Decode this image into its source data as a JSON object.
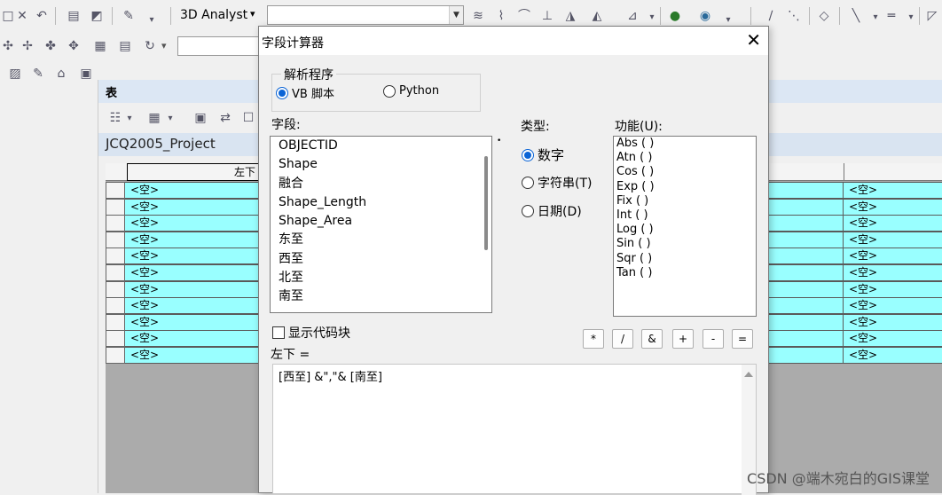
{
  "toolbar": {
    "analyst_label": "3D Analyst",
    "analyst_arrow": "▾",
    "refresh_arrow": "▾"
  },
  "table_window": {
    "title": "表",
    "table_name": "JCQ2005_Project",
    "column_header": "左下",
    "null_value": "<空>",
    "row_count_visible": 11
  },
  "dialog": {
    "title": "字段计算器",
    "close_label": "✕",
    "parser_legend": "解析程序",
    "parser_options": [
      "VB 脚本",
      "Python"
    ],
    "fields_label": "字段:",
    "fields": [
      "OBJECTID",
      "Shape",
      "融合",
      "Shape_Length",
      "Shape_Area",
      "东至",
      "西至",
      "北至",
      "南至"
    ],
    "type_label": "类型:",
    "type_options": [
      "数字",
      "字符串(T)",
      "日期(D)"
    ],
    "functions_label": "功能(U):",
    "functions": [
      "Abs ( )",
      "Atn ( )",
      "Cos ( )",
      "Exp ( )",
      "Fix ( )",
      "Int ( )",
      "Log ( )",
      "Sin ( )",
      "Sqr ( )",
      "Tan ( )"
    ],
    "show_codeblock_label": "显示代码块",
    "operators": [
      "*",
      "/",
      "&",
      "+",
      "-",
      "="
    ],
    "target_label": "左下 =",
    "expression": "[西至] &\",\"& [南至]"
  },
  "watermark": "CSDN @端木宛白的GIS课堂",
  "colors": {
    "row_highlight": "#99ffff",
    "radio_selected": "#0a64d6",
    "title_bar": "#ffffff"
  }
}
